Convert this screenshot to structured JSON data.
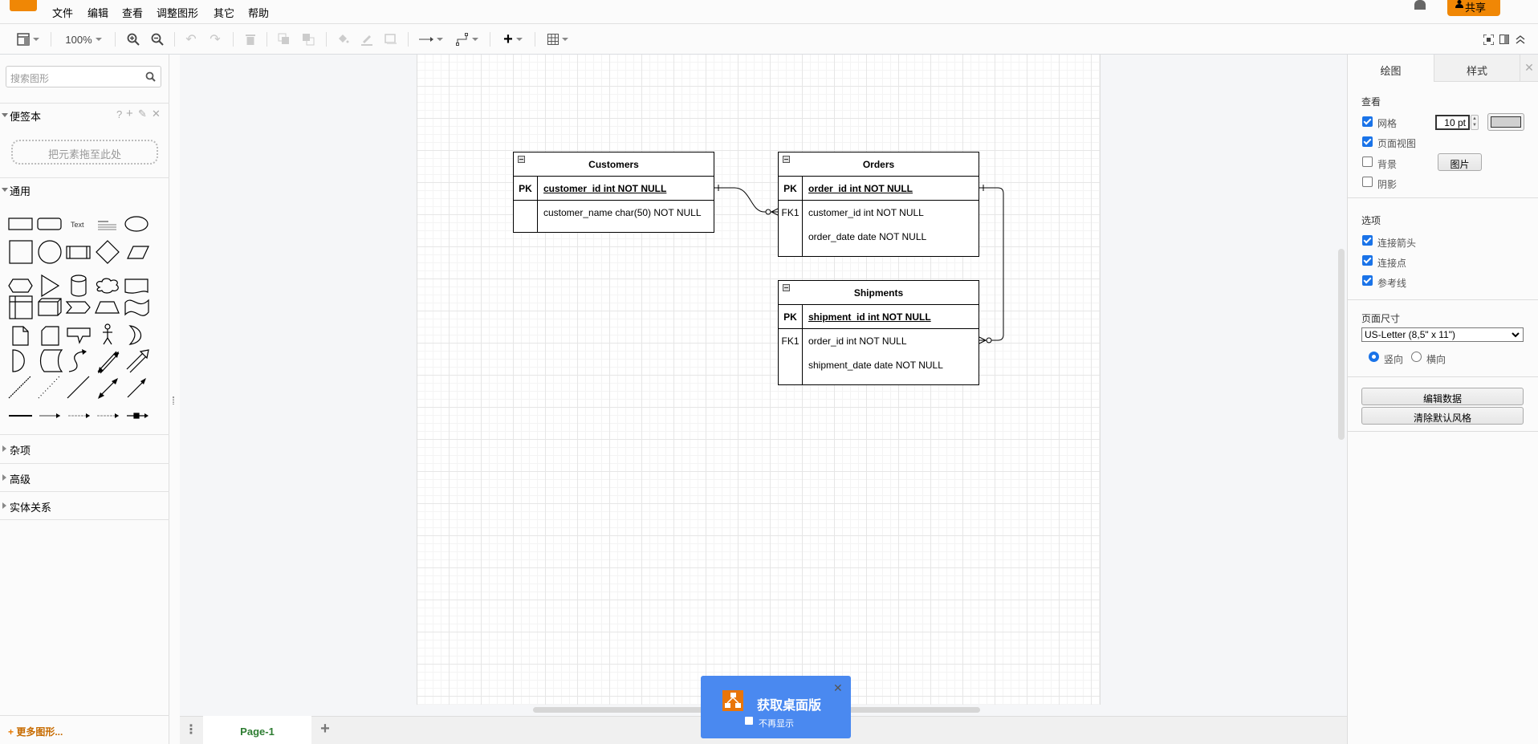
{
  "menubar": {
    "items": [
      "文件",
      "编辑",
      "查看",
      "调整图形",
      "其它",
      "帮助"
    ],
    "share_label": "共享"
  },
  "toolbar": {
    "zoom_level": "100%"
  },
  "sidebar": {
    "search_placeholder": "搜索图形",
    "scratchpad": {
      "title": "便签本",
      "drop_hint": "把元素拖至此处",
      "actions": [
        "?",
        "+",
        "✎",
        "✕"
      ]
    },
    "general": {
      "title": "通用",
      "text_shape_label": "Text"
    },
    "collapsed_sections": [
      "杂项",
      "高级",
      "实体关系"
    ],
    "more_shapes": "更多图形..."
  },
  "diagram": {
    "tables": [
      {
        "name": "Customers",
        "rows": [
          {
            "key": "PK",
            "field": "customer_id int NOT NULL",
            "primary": true
          },
          {
            "key": "",
            "field": "customer_name char(50) NOT NULL",
            "primary": false
          }
        ]
      },
      {
        "name": "Orders",
        "rows": [
          {
            "key": "PK",
            "field": "order_id int NOT NULL",
            "primary": true
          },
          {
            "key": "FK1",
            "field": "customer_id int NOT NULL",
            "primary": false
          },
          {
            "key": "",
            "field": "order_date date NOT NULL",
            "primary": false
          }
        ]
      },
      {
        "name": "Shipments",
        "rows": [
          {
            "key": "PK",
            "field": "shipment_id int NOT NULL",
            "primary": true
          },
          {
            "key": "FK1",
            "field": "order_id int NOT NULL",
            "primary": false
          },
          {
            "key": "",
            "field": "shipment_date date NOT NULL",
            "primary": false
          }
        ]
      }
    ],
    "relations": [
      {
        "from": "Customers.customer_id",
        "to": "Orders.customer_id",
        "from_end": "one",
        "to_end": "zero-or-many"
      },
      {
        "from": "Orders.order_id",
        "to": "Shipments.order_id",
        "from_end": "one",
        "to_end": "zero-or-many"
      }
    ]
  },
  "right_panel": {
    "tabs": [
      "绘图",
      "样式"
    ],
    "view_section": {
      "title": "查看",
      "grid": {
        "label": "网格",
        "checked": true,
        "size": "10 pt"
      },
      "page_view": {
        "label": "页面视图",
        "checked": true
      },
      "background": {
        "label": "背景",
        "checked": false,
        "button": "图片"
      },
      "shadow": {
        "label": "阴影",
        "checked": false
      }
    },
    "options_section": {
      "title": "选项",
      "items": [
        {
          "label": "连接箭头",
          "checked": true
        },
        {
          "label": "连接点",
          "checked": true
        },
        {
          "label": "参考线",
          "checked": true
        }
      ]
    },
    "page_size": {
      "title": "页面尺寸",
      "selected": "US-Letter (8,5\" x 11\")",
      "portrait": "竖向",
      "landscape": "横向",
      "orientation": "portrait"
    },
    "buttons": [
      "编辑数据",
      "清除默认风格"
    ]
  },
  "pages": {
    "current": "Page-1"
  },
  "popup": {
    "title": "获取桌面版",
    "dont_show": "不再显示"
  }
}
